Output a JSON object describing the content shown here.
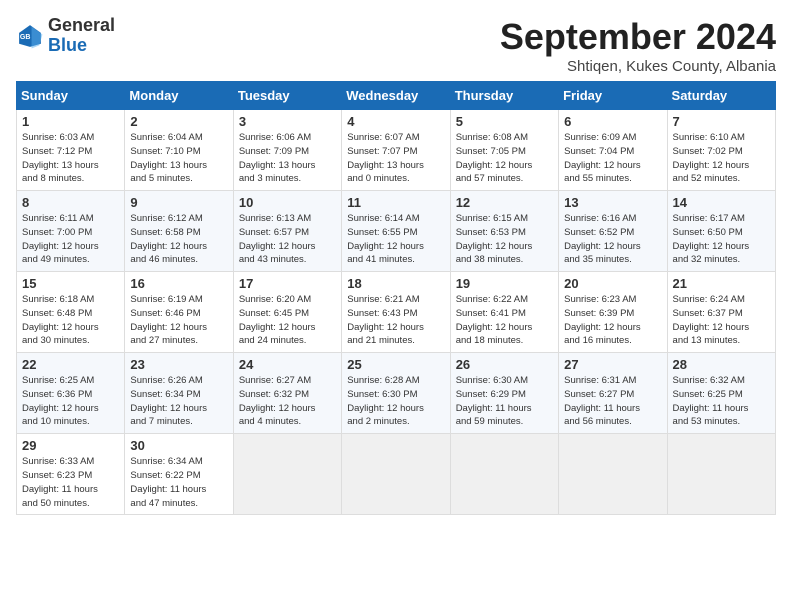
{
  "header": {
    "logo_general": "General",
    "logo_blue": "Blue",
    "month_title": "September 2024",
    "subtitle": "Shtiqen, Kukes County, Albania"
  },
  "weekdays": [
    "Sunday",
    "Monday",
    "Tuesday",
    "Wednesday",
    "Thursday",
    "Friday",
    "Saturday"
  ],
  "weeks": [
    [
      {
        "day": "1",
        "info": "Sunrise: 6:03 AM\nSunset: 7:12 PM\nDaylight: 13 hours\nand 8 minutes."
      },
      {
        "day": "2",
        "info": "Sunrise: 6:04 AM\nSunset: 7:10 PM\nDaylight: 13 hours\nand 5 minutes."
      },
      {
        "day": "3",
        "info": "Sunrise: 6:06 AM\nSunset: 7:09 PM\nDaylight: 13 hours\nand 3 minutes."
      },
      {
        "day": "4",
        "info": "Sunrise: 6:07 AM\nSunset: 7:07 PM\nDaylight: 13 hours\nand 0 minutes."
      },
      {
        "day": "5",
        "info": "Sunrise: 6:08 AM\nSunset: 7:05 PM\nDaylight: 12 hours\nand 57 minutes."
      },
      {
        "day": "6",
        "info": "Sunrise: 6:09 AM\nSunset: 7:04 PM\nDaylight: 12 hours\nand 55 minutes."
      },
      {
        "day": "7",
        "info": "Sunrise: 6:10 AM\nSunset: 7:02 PM\nDaylight: 12 hours\nand 52 minutes."
      }
    ],
    [
      {
        "day": "8",
        "info": "Sunrise: 6:11 AM\nSunset: 7:00 PM\nDaylight: 12 hours\nand 49 minutes."
      },
      {
        "day": "9",
        "info": "Sunrise: 6:12 AM\nSunset: 6:58 PM\nDaylight: 12 hours\nand 46 minutes."
      },
      {
        "day": "10",
        "info": "Sunrise: 6:13 AM\nSunset: 6:57 PM\nDaylight: 12 hours\nand 43 minutes."
      },
      {
        "day": "11",
        "info": "Sunrise: 6:14 AM\nSunset: 6:55 PM\nDaylight: 12 hours\nand 41 minutes."
      },
      {
        "day": "12",
        "info": "Sunrise: 6:15 AM\nSunset: 6:53 PM\nDaylight: 12 hours\nand 38 minutes."
      },
      {
        "day": "13",
        "info": "Sunrise: 6:16 AM\nSunset: 6:52 PM\nDaylight: 12 hours\nand 35 minutes."
      },
      {
        "day": "14",
        "info": "Sunrise: 6:17 AM\nSunset: 6:50 PM\nDaylight: 12 hours\nand 32 minutes."
      }
    ],
    [
      {
        "day": "15",
        "info": "Sunrise: 6:18 AM\nSunset: 6:48 PM\nDaylight: 12 hours\nand 30 minutes."
      },
      {
        "day": "16",
        "info": "Sunrise: 6:19 AM\nSunset: 6:46 PM\nDaylight: 12 hours\nand 27 minutes."
      },
      {
        "day": "17",
        "info": "Sunrise: 6:20 AM\nSunset: 6:45 PM\nDaylight: 12 hours\nand 24 minutes."
      },
      {
        "day": "18",
        "info": "Sunrise: 6:21 AM\nSunset: 6:43 PM\nDaylight: 12 hours\nand 21 minutes."
      },
      {
        "day": "19",
        "info": "Sunrise: 6:22 AM\nSunset: 6:41 PM\nDaylight: 12 hours\nand 18 minutes."
      },
      {
        "day": "20",
        "info": "Sunrise: 6:23 AM\nSunset: 6:39 PM\nDaylight: 12 hours\nand 16 minutes."
      },
      {
        "day": "21",
        "info": "Sunrise: 6:24 AM\nSunset: 6:37 PM\nDaylight: 12 hours\nand 13 minutes."
      }
    ],
    [
      {
        "day": "22",
        "info": "Sunrise: 6:25 AM\nSunset: 6:36 PM\nDaylight: 12 hours\nand 10 minutes."
      },
      {
        "day": "23",
        "info": "Sunrise: 6:26 AM\nSunset: 6:34 PM\nDaylight: 12 hours\nand 7 minutes."
      },
      {
        "day": "24",
        "info": "Sunrise: 6:27 AM\nSunset: 6:32 PM\nDaylight: 12 hours\nand 4 minutes."
      },
      {
        "day": "25",
        "info": "Sunrise: 6:28 AM\nSunset: 6:30 PM\nDaylight: 12 hours\nand 2 minutes."
      },
      {
        "day": "26",
        "info": "Sunrise: 6:30 AM\nSunset: 6:29 PM\nDaylight: 11 hours\nand 59 minutes."
      },
      {
        "day": "27",
        "info": "Sunrise: 6:31 AM\nSunset: 6:27 PM\nDaylight: 11 hours\nand 56 minutes."
      },
      {
        "day": "28",
        "info": "Sunrise: 6:32 AM\nSunset: 6:25 PM\nDaylight: 11 hours\nand 53 minutes."
      }
    ],
    [
      {
        "day": "29",
        "info": "Sunrise: 6:33 AM\nSunset: 6:23 PM\nDaylight: 11 hours\nand 50 minutes."
      },
      {
        "day": "30",
        "info": "Sunrise: 6:34 AM\nSunset: 6:22 PM\nDaylight: 11 hours\nand 47 minutes."
      },
      {
        "day": "",
        "info": ""
      },
      {
        "day": "",
        "info": ""
      },
      {
        "day": "",
        "info": ""
      },
      {
        "day": "",
        "info": ""
      },
      {
        "day": "",
        "info": ""
      }
    ]
  ]
}
